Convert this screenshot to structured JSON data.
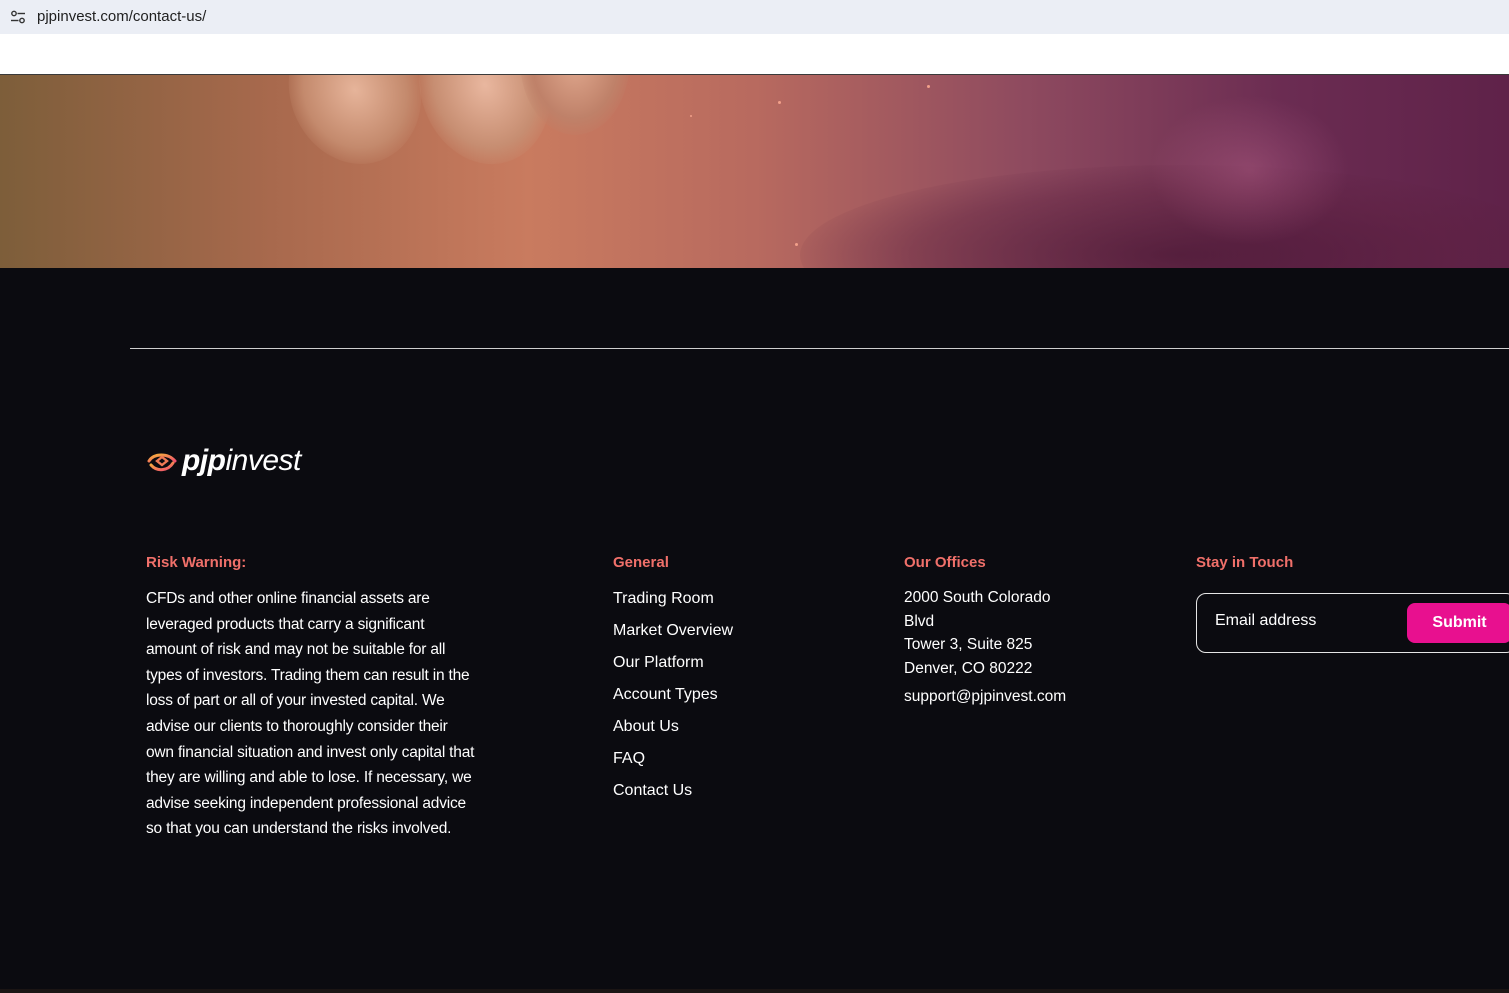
{
  "browser": {
    "url": "pjpinvest.com/contact-us/"
  },
  "logo": {
    "brand_bold": "pjp",
    "brand_light": "invest"
  },
  "risk": {
    "title": "Risk Warning:",
    "text": "CFDs and other online financial assets are leveraged products that carry a significant amount of risk and may not be suitable for all types of investors. Trading them can result in the loss of part or all of your invested capital. We advise our clients to thoroughly consider their own financial situation and invest only capital that they are willing and able to lose. If necessary, we advise seeking independent professional advice so that you can understand the risks involved."
  },
  "general": {
    "title": "General",
    "links": [
      "Trading Room",
      "Market Overview",
      "Our Platform",
      "Account Types",
      "About Us",
      "FAQ",
      "Contact Us"
    ]
  },
  "offices": {
    "title": "Our Offices",
    "address_line1": "2000 South Colorado",
    "address_line2": "Blvd",
    "address_line3": "Tower 3, Suite 825",
    "address_line4": "Denver, CO 80222",
    "email": "support@pjpinvest.com"
  },
  "stay": {
    "title": "Stay in Touch",
    "placeholder": "Email address",
    "submit_label": "Submit"
  },
  "colors": {
    "accent_title": "#f0706a",
    "submit_bg": "#e8108f",
    "footer_bg": "#0b0b10"
  }
}
